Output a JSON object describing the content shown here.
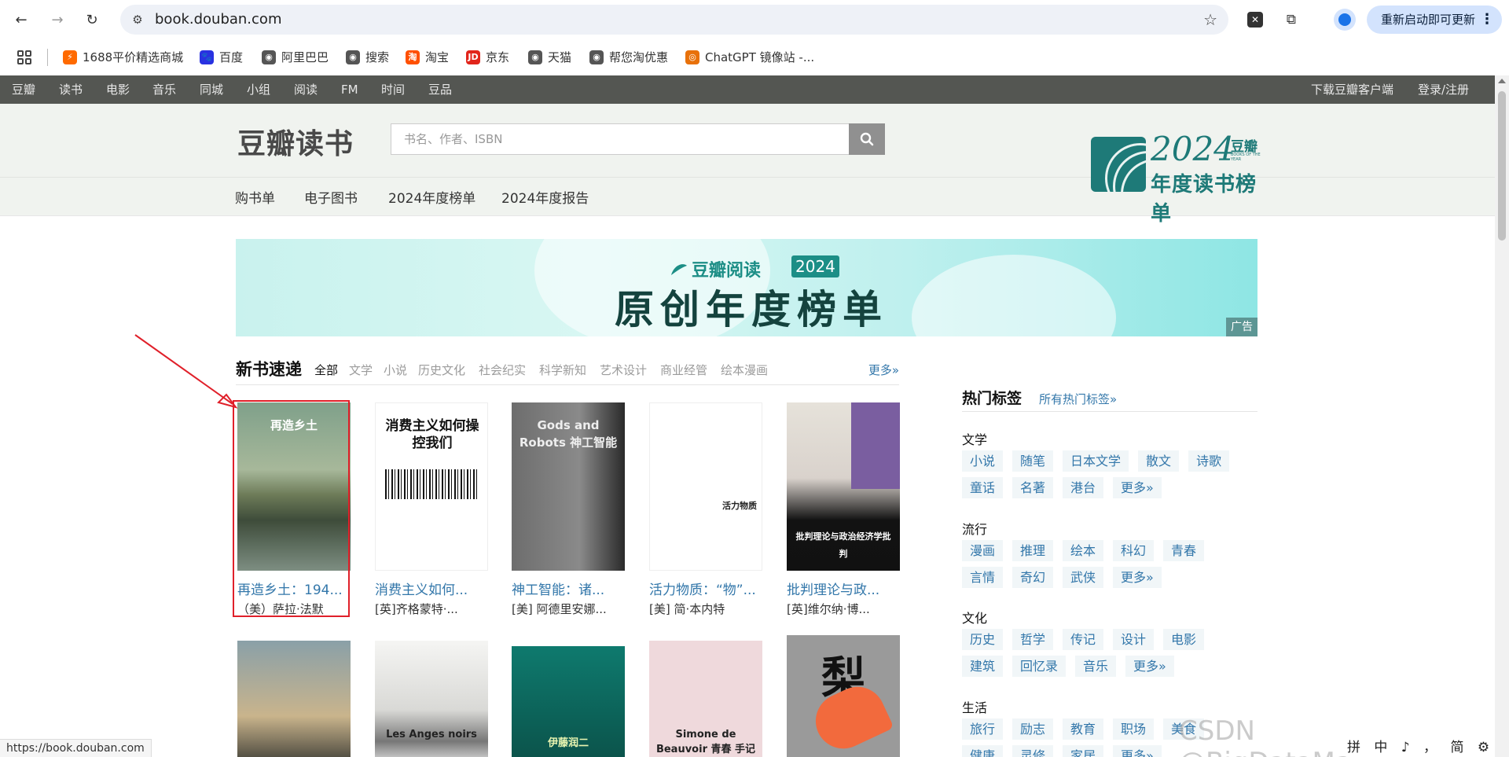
{
  "browser": {
    "url": "book.douban.com",
    "update_label": "重新启动即可更新",
    "icons": [
      "back-arrow-icon",
      "forward-arrow-icon",
      "reload-icon",
      "site-settings-icon",
      "bookmark-star-icon",
      "extension-x-icon",
      "extensions-puzzle-icon",
      "profile-icon",
      "more-vert-icon"
    ]
  },
  "bookmarks": [
    {
      "label": "1688平价精选商城",
      "color": "#ff6a00",
      "glyph": "⚡"
    },
    {
      "label": "百度",
      "color": "#2932e1",
      "glyph": "🐾"
    },
    {
      "label": "阿里巴巴",
      "color": "#555555",
      "glyph": "◉"
    },
    {
      "label": "搜索",
      "color": "#555555",
      "glyph": "◉"
    },
    {
      "label": "淘宝",
      "color": "#ff5000",
      "glyph": "淘"
    },
    {
      "label": "京东",
      "color": "#e1251b",
      "glyph": "JD"
    },
    {
      "label": "天猫",
      "color": "#555555",
      "glyph": "◉"
    },
    {
      "label": "帮您淘优惠",
      "color": "#555555",
      "glyph": "◉"
    },
    {
      "label": "ChatGPT 镜像站 -...",
      "color": "#e8710a",
      "glyph": "◎"
    }
  ],
  "global_nav": {
    "items": [
      "豆瓣",
      "读书",
      "电影",
      "音乐",
      "同城",
      "小组",
      "阅读",
      "FM",
      "时间",
      "豆品"
    ],
    "download": "下载豆瓣客户端",
    "login": "登录/注册"
  },
  "header": {
    "logo": "豆瓣读书",
    "search_placeholder": "书名、作者、ISBN",
    "sub_nav": [
      "购书单",
      "电子图书",
      "2024年度榜单",
      "2024年度报告"
    ],
    "badge": {
      "year": "2024",
      "brand": "豆瓣",
      "books_of_year": "BOOKS OF THE YEAR",
      "subtitle": "年度读书榜单"
    }
  },
  "banner": {
    "brand": "豆瓣阅读",
    "year": "2024",
    "headline": "原创年度榜单",
    "ad_label": "广告"
  },
  "new_books": {
    "title": "新书速递",
    "categories": [
      "全部",
      "文学",
      "小说",
      "历史文化",
      "社会纪实",
      "科学新知",
      "艺术设计",
      "商业经管",
      "绘本漫画"
    ],
    "more": "更多»",
    "books": [
      {
        "title": "再造乡土：194...",
        "author": "（美）萨拉·法默",
        "cover_text": "再造乡土"
      },
      {
        "title": "消费主义如何...",
        "author": "[英]齐格蒙特·...",
        "cover_text": "消费主义如何操控我们"
      },
      {
        "title": "神工智能：诸...",
        "author": "[美] 阿德里安娜...",
        "cover_text": "Gods and Robots 神工智能"
      },
      {
        "title": "活力物质：“物”...",
        "author": "[美] 简·本内特",
        "cover_text": "活力物质"
      },
      {
        "title": "批判理论与政...",
        "author": "[英]维尔纳·博...",
        "cover_text": "批判理论与政治经济学批判"
      }
    ],
    "row2_covers": [
      "",
      "Les Anges noirs",
      "伊藤润二",
      "Simone de Beauvoir 青春 手记",
      "梨"
    ]
  },
  "hot_tags": {
    "title": "热门标签",
    "all_link": "所有热门标签»",
    "groups": [
      {
        "name": "文学",
        "rows": [
          [
            "小说",
            "随笔",
            "日本文学",
            "散文",
            "诗歌"
          ],
          [
            "童话",
            "名著",
            "港台",
            "更多»"
          ]
        ]
      },
      {
        "name": "流行",
        "rows": [
          [
            "漫画",
            "推理",
            "绘本",
            "科幻",
            "青春"
          ],
          [
            "言情",
            "奇幻",
            "武侠",
            "更多»"
          ]
        ]
      },
      {
        "name": "文化",
        "rows": [
          [
            "历史",
            "哲学",
            "传记",
            "设计",
            "电影"
          ],
          [
            "建筑",
            "回忆录",
            "音乐",
            "更多»"
          ]
        ]
      },
      {
        "name": "生活",
        "rows": [
          [
            "旅行",
            "励志",
            "教育",
            "职场",
            "美食"
          ],
          [
            "健康",
            "灵修",
            "家居",
            "更多»"
          ]
        ]
      }
    ]
  },
  "status_url": "https://book.douban.com",
  "watermark": "CSDN @BigDataMagician",
  "ime": "拼 中 ♪ ， 简 ⚙"
}
